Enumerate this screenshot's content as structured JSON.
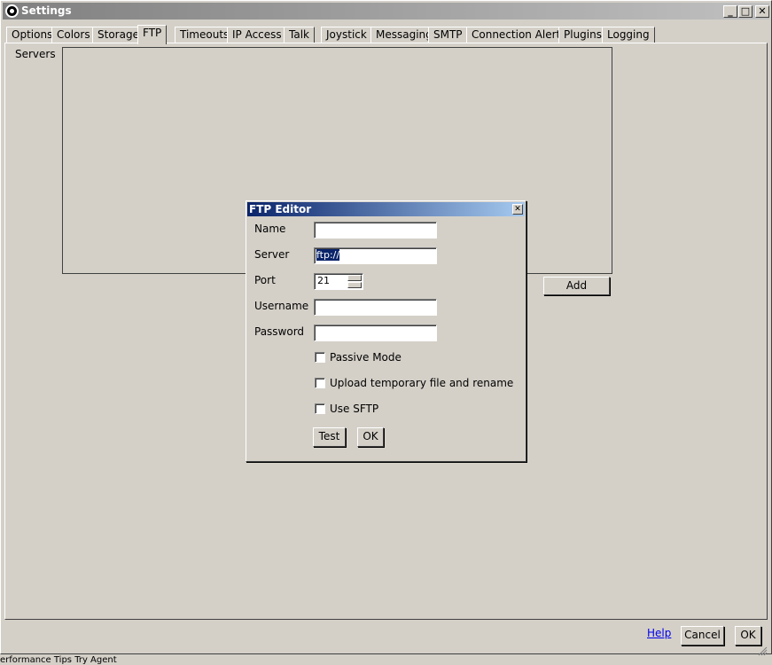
{
  "window": {
    "title": "Settings",
    "minimize_glyph": "_",
    "maximize_glyph": "□",
    "close_glyph": "✕"
  },
  "tabs": [
    {
      "label": "Options"
    },
    {
      "label": "Colors"
    },
    {
      "label": "Storage"
    },
    {
      "label": "FTP",
      "active": true
    },
    {
      "label": "Timeouts"
    },
    {
      "label": "IP Access"
    },
    {
      "label": "Talk"
    },
    {
      "label": "Joystick"
    },
    {
      "label": "Messaging"
    },
    {
      "label": "SMTP"
    },
    {
      "label": "Connection Alerts"
    },
    {
      "label": "Plugins"
    },
    {
      "label": "Logging"
    }
  ],
  "ftp": {
    "servers_label": "Servers",
    "add_label": "Add"
  },
  "footer": {
    "help_label": "Help",
    "cancel_label": "Cancel",
    "ok_label": "OK",
    "status_text": "erformance  Tips  Try  Agent"
  },
  "dialog": {
    "title": "FTP Editor",
    "close_glyph": "✕",
    "name_label": "Name",
    "name_value": "",
    "server_label": "Server",
    "server_value": "ftp://",
    "port_label": "Port",
    "port_value": "21",
    "username_label": "Username",
    "username_value": "",
    "password_label": "Password",
    "password_value": "",
    "passive_label": "Passive Mode",
    "passive_checked": false,
    "upload_temp_label": "Upload temporary file and rename",
    "upload_temp_checked": false,
    "sftp_label": "Use SFTP",
    "sftp_checked": false,
    "test_label": "Test",
    "ok_label": "OK"
  },
  "colors": {
    "face": "#d4d0c8",
    "dialog_title_start": "#0a246a",
    "dialog_title_end": "#a6caf0",
    "link": "#0000ee"
  }
}
